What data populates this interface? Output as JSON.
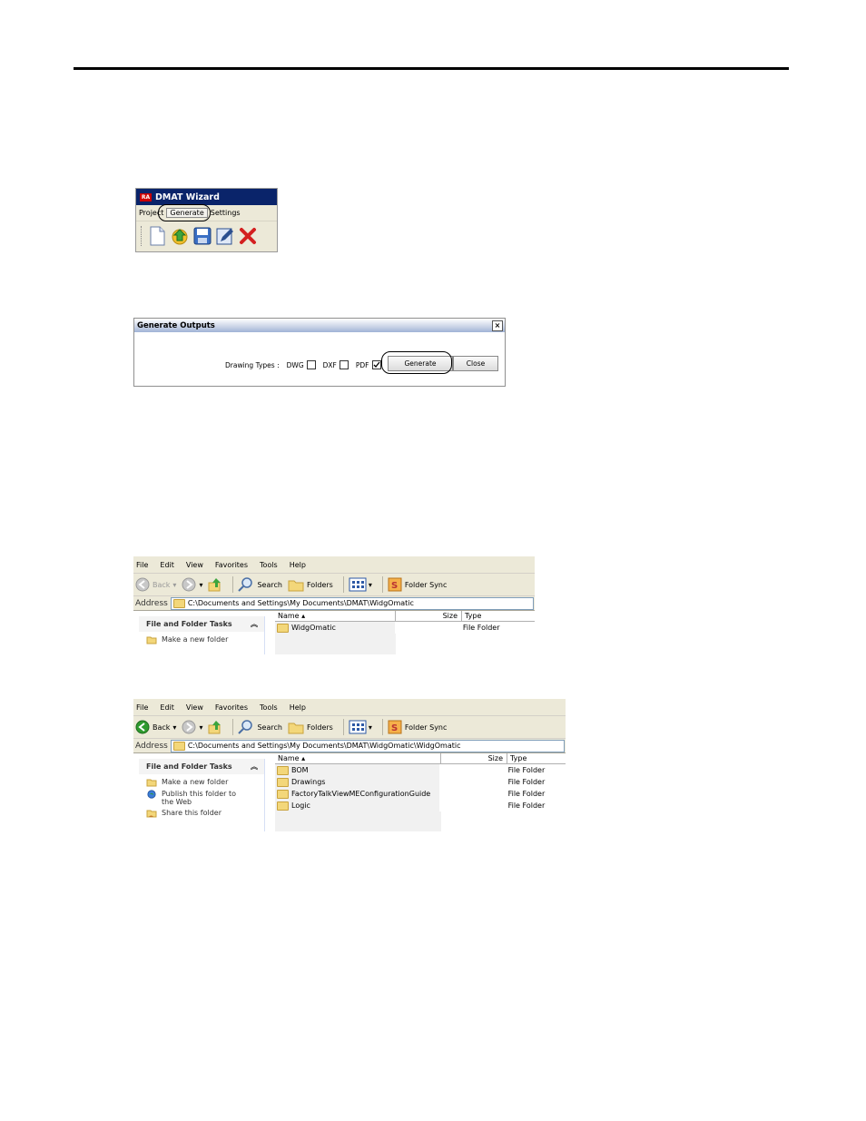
{
  "wizard": {
    "title": "DMAT Wizard",
    "logo_text": "RA",
    "menu": [
      "Project",
      "Generate",
      "Settings"
    ],
    "tools": [
      "new-document-icon",
      "open-icon",
      "save-icon",
      "edit-icon",
      "delete-icon"
    ]
  },
  "generate_dialog": {
    "title": "Generate Outputs",
    "drawing_types_label": "Drawing Types :",
    "options": [
      {
        "label": "DWG",
        "checked": false
      },
      {
        "label": "DXF",
        "checked": false
      },
      {
        "label": "PDF",
        "checked": true
      }
    ],
    "generate_label": "Generate",
    "close_label": "Close",
    "close_glyph": "×"
  },
  "explorer1": {
    "menu": [
      "File",
      "Edit",
      "View",
      "Favorites",
      "Tools",
      "Help"
    ],
    "toolbar": {
      "back": "Back",
      "search": "Search",
      "folders": "Folders",
      "folder_sync": "Folder Sync"
    },
    "address_label": "Address",
    "address": "C:\\Documents and Settings\\My Documents\\DMAT\\WidgOmatic",
    "tasks_title": "File and Folder Tasks",
    "tasks": [
      "Make a new folder"
    ],
    "columns": {
      "name": "Name",
      "size": "Size",
      "type": "Type"
    },
    "rows": [
      {
        "name": "WidgOmatic",
        "type": "File Folder"
      }
    ]
  },
  "explorer2": {
    "menu": [
      "File",
      "Edit",
      "View",
      "Favorites",
      "Tools",
      "Help"
    ],
    "toolbar": {
      "back": "Back",
      "search": "Search",
      "folders": "Folders",
      "folder_sync": "Folder Sync"
    },
    "address_label": "Address",
    "address": "C:\\Documents and Settings\\My Documents\\DMAT\\WidgOmatic\\WidgOmatic",
    "tasks_title": "File and Folder Tasks",
    "tasks": [
      "Make a new folder",
      "Publish this folder to the Web",
      "Share this folder"
    ],
    "columns": {
      "name": "Name",
      "size": "Size",
      "type": "Type"
    },
    "rows": [
      {
        "name": "BOM",
        "type": "File Folder"
      },
      {
        "name": "Drawings",
        "type": "File Folder"
      },
      {
        "name": "FactoryTalkViewMEConfigurationGuide",
        "type": "File Folder"
      },
      {
        "name": "Logic",
        "type": "File Folder"
      }
    ]
  }
}
